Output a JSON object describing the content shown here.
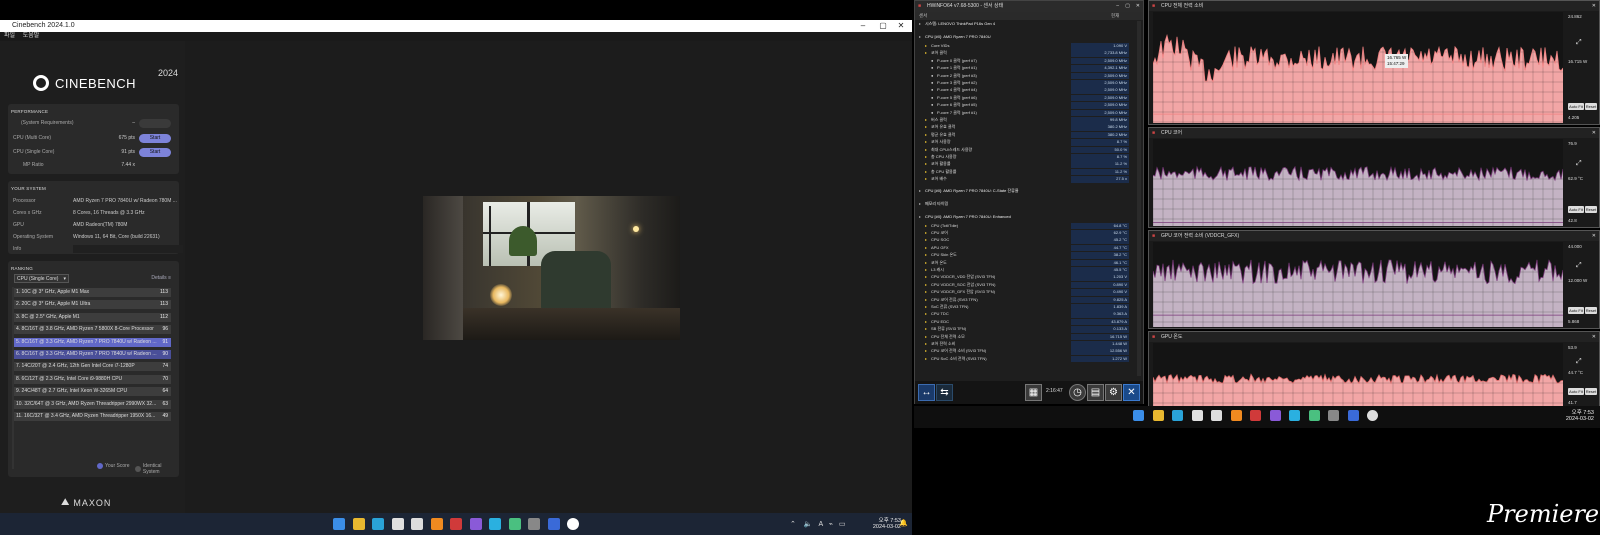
{
  "cinebench": {
    "title": "Cinebench 2024.1.0",
    "menu": [
      "파일",
      "도움말"
    ],
    "logo": "CINEBENCH",
    "year": "2024",
    "performance": {
      "heading": "PERFORMANCE",
      "sysreq": "(System Requirements)",
      "sysreq_dash": "–",
      "multi_label": "CPU (Multi Core)",
      "multi_value": "675 pts",
      "single_label": "CPU (Single Core)",
      "single_value": "91 pts",
      "mp_label": "MP Ratio",
      "mp_value": "7.44 x",
      "start": "Start"
    },
    "system": {
      "heading": "YOUR SYSTEM",
      "rows": [
        {
          "label": "Processor",
          "value": "AMD Ryzen 7 PRO 7840U w/ Radeon 780M ..."
        },
        {
          "label": "Cores x GHz",
          "value": "8 Cores, 16 Threads @ 3.3 GHz"
        },
        {
          "label": "GPU",
          "value": "AMD Radeon(TM) 780M"
        },
        {
          "label": "Operating System",
          "value": "Windows 11, 64 Bit, Core (build 22631)"
        },
        {
          "label": "Info",
          "value": ""
        }
      ]
    },
    "ranking": {
      "heading": "RANKING",
      "dropdown": "CPU (Single Core)",
      "details": "Details",
      "items": [
        {
          "name": "1. 10C @ 3* GHz, Apple M1 Max",
          "score": "113"
        },
        {
          "name": "2. 20C @ 3* GHz, Apple M1 Ultra",
          "score": "113"
        },
        {
          "name": "3. 8C @ 2.5* GHz, Apple M1",
          "score": "112"
        },
        {
          "name": "4. 8C/16T @ 3.8 GHz, AMD Ryzen 7 5800X 8-Core Processor",
          "score": "96"
        },
        {
          "name": "5. 8C/16T @ 3.3 GHz, AMD Ryzen 7 PRO 7840U w/ Radeon ...",
          "score": "91"
        },
        {
          "name": "6. 8C/16T @ 3.3 GHz, AMD Ryzen 7 PRO 7840U w/ Radeon ...",
          "score": "90"
        },
        {
          "name": "7. 14C/20T @ 2.4 GHz, 12th Gen Intel Core i7-1280P",
          "score": "74"
        },
        {
          "name": "8. 6C/12T @ 2.3 GHz, Intel Core i9-9880H CPU",
          "score": "70"
        },
        {
          "name": "9. 24C/48T @ 2.7 GHz, Intel Xeon W-3265M CPU",
          "score": "64"
        },
        {
          "name": "10. 32C/64T @ 3 GHz, AMD Ryzen Threadripper 2990WX 32...",
          "score": "63"
        },
        {
          "name": "11. 16C/32T @ 3.4 GHz, AMD Ryzen Threadripper 1950X 16...",
          "score": "49"
        }
      ],
      "legend_your": "Your Score",
      "legend_identical": "Identical System"
    },
    "maxon": "MAXON"
  },
  "hwinfo": {
    "title": "HWiNFO64 v7.68-5300 - 센서 상태",
    "col_sensor": "센서",
    "col_current": "현재",
    "rows": [
      {
        "indent": 0,
        "label": "시스템: LENOVO ThinkPad P16s Gen 4",
        "value": "",
        "group": true
      },
      {
        "indent": 0,
        "label": "CPU [#0]: AMD Ryzen 7 PRO 7840U",
        "value": "",
        "group": true
      },
      {
        "indent": 1,
        "label": "Core VIDs",
        "value": "1.090 V"
      },
      {
        "indent": 1,
        "label": "코어 클럭",
        "value": "2,733.8 MHz"
      },
      {
        "indent": 2,
        "label": "P-core 0 클럭 (perf #7)",
        "value": "2,509.0 MHz"
      },
      {
        "indent": 2,
        "label": "P-core 1 클럭 (perf #1)",
        "value": "4,392.1 MHz"
      },
      {
        "indent": 2,
        "label": "P-core 2 클럭 (perf #3)",
        "value": "2,509.0 MHz"
      },
      {
        "indent": 2,
        "label": "P-core 3 클럭 (perf #2)",
        "value": "2,509.0 MHz"
      },
      {
        "indent": 2,
        "label": "P-core 4 클럭 (perf #4)",
        "value": "2,509.0 MHz"
      },
      {
        "indent": 2,
        "label": "P-core 5 클럭 (perf #6)",
        "value": "2,509.0 MHz"
      },
      {
        "indent": 2,
        "label": "P-core 6 클럭 (perf #5)",
        "value": "2,509.0 MHz"
      },
      {
        "indent": 2,
        "label": "P-core 7 클럭 (perf #1)",
        "value": "2,509.0 MHz"
      },
      {
        "indent": 1,
        "label": "버스 클럭",
        "value": "99.8 MHz"
      },
      {
        "indent": 1,
        "label": "코어 유효 클럭",
        "value": "380.2 MHz"
      },
      {
        "indent": 1,
        "label": "평균 유효 클럭",
        "value": "380.2 MHz"
      },
      {
        "indent": 1,
        "label": "코어 사용량",
        "value": "8.7 %"
      },
      {
        "indent": 1,
        "label": "최대 CPU/스레드 사용량",
        "value": "50.0 %"
      },
      {
        "indent": 1,
        "label": "총 CPU 사용량",
        "value": "8.7 %"
      },
      {
        "indent": 1,
        "label": "코어 활용률",
        "value": "11.2 %"
      },
      {
        "indent": 1,
        "label": "총 CPU 활용률",
        "value": "11.2 %"
      },
      {
        "indent": 1,
        "label": "코어 배수",
        "value": "27.5 x"
      },
      {
        "indent": 0,
        "label": "CPU [#0]: AMD Ryzen 7 PRO 7840U: C-State 잔류율",
        "value": "",
        "group": true
      },
      {
        "indent": 0,
        "label": "메모리 타이밍",
        "value": "",
        "group": true
      },
      {
        "indent": 0,
        "label": "CPU [#0]: AMD Ryzen 7 PRO 7840U: Enhanced",
        "value": "",
        "group": true
      },
      {
        "indent": 1,
        "label": "CPU (Tctl/Tdie)",
        "value": "64.8 °C"
      },
      {
        "indent": 1,
        "label": "CPU 코어",
        "value": "62.9 °C"
      },
      {
        "indent": 1,
        "label": "CPU SOC",
        "value": "45.2 °C"
      },
      {
        "indent": 1,
        "label": "APU GFX",
        "value": "44.7 °C"
      },
      {
        "indent": 1,
        "label": "CPU Skin 온도",
        "value": "38.2 °C"
      },
      {
        "indent": 1,
        "label": "코어 온도",
        "value": "46.1 °C"
      },
      {
        "indent": 1,
        "label": "L3 캐시",
        "value": "45.5 °C"
      },
      {
        "indent": 1,
        "label": "CPU VDDCR_VDD 전압 (SVI3 TFN)",
        "value": "1.203 V"
      },
      {
        "indent": 1,
        "label": "CPU VDDCR_SOC 전압 (SVI3 TFN)",
        "value": "0.890 V"
      },
      {
        "indent": 1,
        "label": "CPU VDDCR_GFX 전압 (SVI3 TFN)",
        "value": "0.490 V"
      },
      {
        "indent": 1,
        "label": "CPU 코어 전류 (SVI3 TFN)",
        "value": "9.825 A"
      },
      {
        "indent": 1,
        "label": "SoC 전류 (SVI3 TFN)",
        "value": "1.839 A"
      },
      {
        "indent": 1,
        "label": "CPU TDC",
        "value": "9.363 A"
      },
      {
        "indent": 1,
        "label": "CPU EDC",
        "value": "43.879 A"
      },
      {
        "indent": 1,
        "label": "SB 전류 (SVI3 TFN)",
        "value": "0.133 A"
      },
      {
        "indent": 1,
        "label": "CPU 전체 전력 소모",
        "value": "16.715 W"
      },
      {
        "indent": 1,
        "label": "코어 전력 소비",
        "value": "1.448 W"
      },
      {
        "indent": 1,
        "label": "CPU 코어 전력 소비 (SVI3 TFN)",
        "value": "12.556 W"
      },
      {
        "indent": 1,
        "label": "CPU SoC 소비 전력 (SVI3 TFN)",
        "value": "1.272 W"
      }
    ],
    "timer": "2:16:47"
  },
  "graphs": [
    {
      "title": "CPU 전체 전력 소비",
      "max": "24.862",
      "cur": "16.715 W",
      "min": "4.205",
      "color": "#f08080",
      "fill": "#f2a6a6",
      "tooltip_val": "16.765 W",
      "tooltip_time": "15:47:29",
      "mean": 0.42,
      "noise": 0.22,
      "base": 0.92
    },
    {
      "title": "CPU 코어",
      "max": "76.9",
      "cur": "62.9 °C",
      "min": "42.8",
      "color": "#7a3a7a",
      "fill": "#c4b3c4",
      "tooltip_val": "",
      "tooltip_time": "",
      "mean": 0.4,
      "noise": 0.16,
      "base": 0.96
    },
    {
      "title": "GPU 코어 전력 소비 (VDDCR_GFX)",
      "max": "44.000",
      "cur": "12.000 W",
      "min": "5.868",
      "color": "#7a3a7a",
      "fill": "#c4b3c4",
      "tooltip_val": "",
      "tooltip_time": "",
      "mean": 0.35,
      "noise": 0.28,
      "base": 0.86
    },
    {
      "title": "GPU 온도",
      "max": "53.9",
      "cur": "44.7 °C",
      "min": "41.7",
      "color": "#e06a6a",
      "fill": "#f2a6a6",
      "tooltip_val": "",
      "tooltip_time": "",
      "mean": 0.55,
      "noise": 0.14,
      "base": 0.98
    }
  ],
  "graph_buttons": {
    "auto_fit": "Auto Fit",
    "reset": "Reset"
  },
  "clock_left": {
    "time": "오후 7:53",
    "date": "2024-03-02"
  },
  "clock_right": {
    "time": "오후 7:53",
    "date": "2024-03-02"
  },
  "watermark": "Premiere"
}
